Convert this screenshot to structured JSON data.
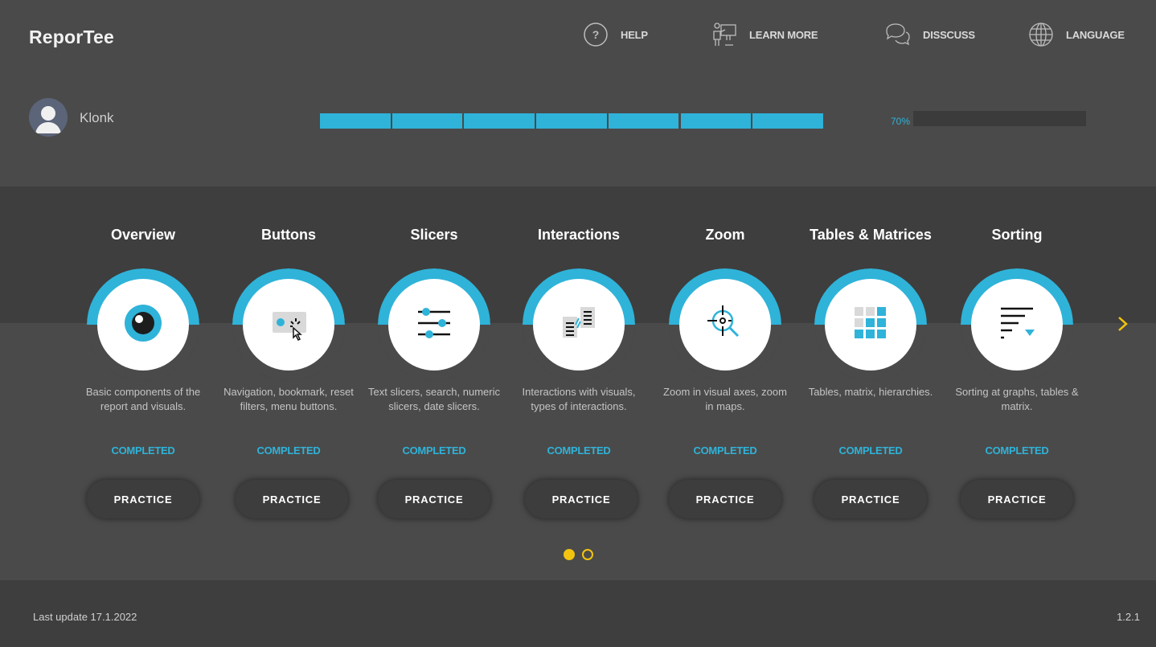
{
  "app": {
    "title": "ReporTee"
  },
  "nav": [
    {
      "label": "HELP",
      "icon": "help-icon"
    },
    {
      "label": "LEARN MORE",
      "icon": "presentation-icon"
    },
    {
      "label": "DISSCUSS",
      "icon": "chat-icon"
    },
    {
      "label": "LANGUAGE",
      "icon": "globe-icon"
    }
  ],
  "user": {
    "name": "Klonk"
  },
  "progress": {
    "percent": 70,
    "label": "70%"
  },
  "modules": [
    {
      "title": "Overview",
      "desc": "Basic components of the report and visuals.",
      "status": "COMPLETED",
      "button": "PRACTICE",
      "icon": "eye-icon"
    },
    {
      "title": "Buttons",
      "desc": "Navigation, bookmark, reset filters, menu buttons.",
      "status": "COMPLETED",
      "button": "PRACTICE",
      "icon": "button-click-icon"
    },
    {
      "title": "Slicers",
      "desc": "Text slicers, search, numeric slicers, date slicers.",
      "status": "COMPLETED",
      "button": "PRACTICE",
      "icon": "sliders-icon"
    },
    {
      "title": "Interactions",
      "desc": "Interactions with visuals, types of interactions.",
      "status": "COMPLETED",
      "button": "PRACTICE",
      "icon": "interactions-icon"
    },
    {
      "title": "Zoom",
      "desc": "Zoom in visual axes, zoom in maps.",
      "status": "COMPLETED",
      "button": "PRACTICE",
      "icon": "zoom-icon"
    },
    {
      "title": "Tables & Matrices",
      "desc": "Tables, matrix, hierarchies.",
      "status": "COMPLETED",
      "button": "PRACTICE",
      "icon": "table-grid-icon"
    },
    {
      "title": "Sorting",
      "desc": "Sorting at graphs, tables & matrix.",
      "status": "COMPLETED",
      "button": "PRACTICE",
      "icon": "sort-icon"
    }
  ],
  "pagination": {
    "pages": 2,
    "current": 1
  },
  "footer": {
    "last_update": "Last update 17.1.2022",
    "version": "1.2.1"
  },
  "colors": {
    "accent": "#2fb3d9",
    "pager": "#f2c40f",
    "background": "#4a4a4a",
    "band": "#3e3e3e"
  }
}
